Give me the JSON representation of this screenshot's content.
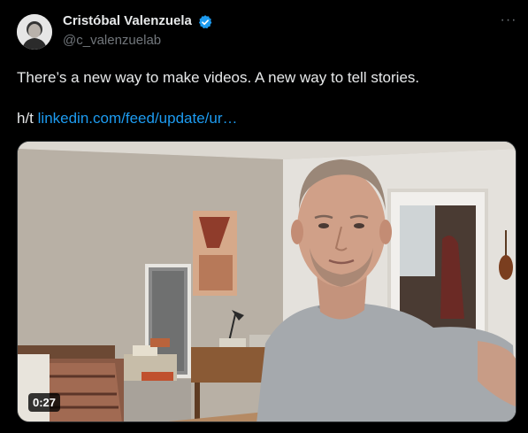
{
  "author": {
    "name": "Cristóbal Valenzuela",
    "handle": "@c_valenzuelab",
    "verified": true,
    "verified_color": "#1d9bf0"
  },
  "more_icon": "more-horizontal-icon",
  "more_label": "···",
  "tweet": {
    "text": "There’s a new way to make videos. A new way to tell stories.",
    "hat_prefix": "h/t",
    "link_text": "linkedin.com/feed/update/ur…"
  },
  "media": {
    "duration": "0:27"
  },
  "colors": {
    "background": "#000000",
    "text": "#e7e9ea",
    "secondary": "#71767b",
    "link": "#1d9bf0"
  }
}
